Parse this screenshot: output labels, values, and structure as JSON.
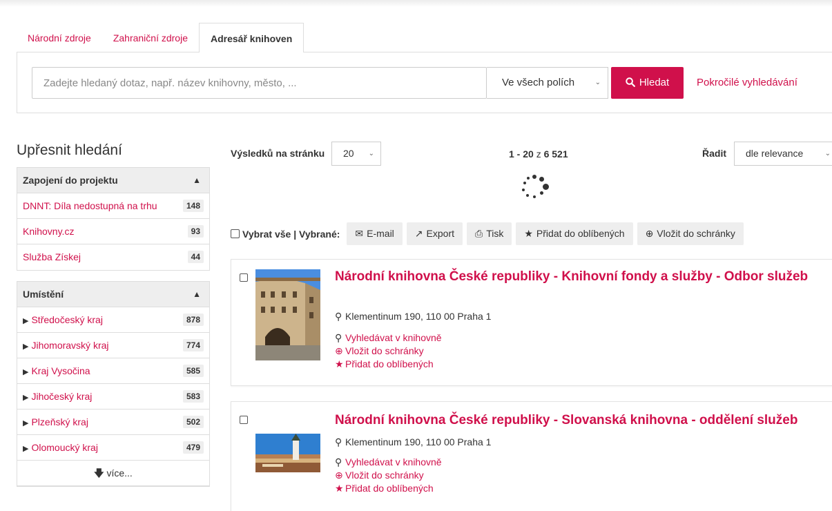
{
  "tabs": [
    {
      "label": "Národní zdroje",
      "active": false
    },
    {
      "label": "Zahraniční zdroje",
      "active": false
    },
    {
      "label": "Adresář knihoven",
      "active": true
    }
  ],
  "search": {
    "placeholder": "Zadejte hledaný dotaz, např. název knihovny, město, ...",
    "field_value": "Ve všech polích",
    "button_label": "Hledat",
    "advanced_label": "Pokročilé vyhledávání"
  },
  "sidebar": {
    "title": "Upřesnit hledání",
    "facet_project": {
      "title": "Zapojení do projektu",
      "items": [
        {
          "label": "DNNT: Díla nedostupná na trhu",
          "count": "148"
        },
        {
          "label": "Knihovny.cz",
          "count": "93"
        },
        {
          "label": "Služba Získej",
          "count": "44"
        }
      ]
    },
    "facet_location": {
      "title": "Umístění",
      "items": [
        {
          "label": "Středočeský kraj",
          "count": "878"
        },
        {
          "label": "Jihomoravský kraj",
          "count": "774"
        },
        {
          "label": "Kraj Vysočina",
          "count": "585"
        },
        {
          "label": "Jihočeský kraj",
          "count": "583"
        },
        {
          "label": "Plzeňský kraj",
          "count": "502"
        },
        {
          "label": "Olomoucký kraj",
          "count": "479"
        }
      ],
      "more_label": "více..."
    }
  },
  "toolbar": {
    "per_page_label": "Výsledků na stránku",
    "per_page_value": "20",
    "range": "1 - 20",
    "range_of": "z",
    "total": "6 521",
    "sort_label": "Řadit",
    "sort_value": "dle relevance"
  },
  "bulk": {
    "select_all": "Vybrat vše | Vybrané:",
    "email": "E-mail",
    "export": "Export",
    "print": "Tisk",
    "favorite": "Přidat do oblíbených",
    "clipboard": "Vložit do schránky"
  },
  "results": [
    {
      "title": "Národní knihovna České republiky - Knihovní fondy a služby - Odbor služeb",
      "address": "Klementinum 190, 110 00 Praha 1",
      "search_in": "Vyhledávat v knihovně",
      "clipboard": "Vložit do schránky",
      "favorite": "Přidat do oblíbených"
    },
    {
      "title": "Národní knihovna České republiky - Slovanská knihovna - oddělení služeb",
      "address": "Klementinum 190, 110 00 Praha 1",
      "search_in": "Vyhledávat v knihovně",
      "clipboard": "Vložit do schránky",
      "favorite": "Přidat do oblíbených"
    }
  ],
  "colors": {
    "accent": "#d0104b",
    "panel_gray": "#eeeeee"
  }
}
